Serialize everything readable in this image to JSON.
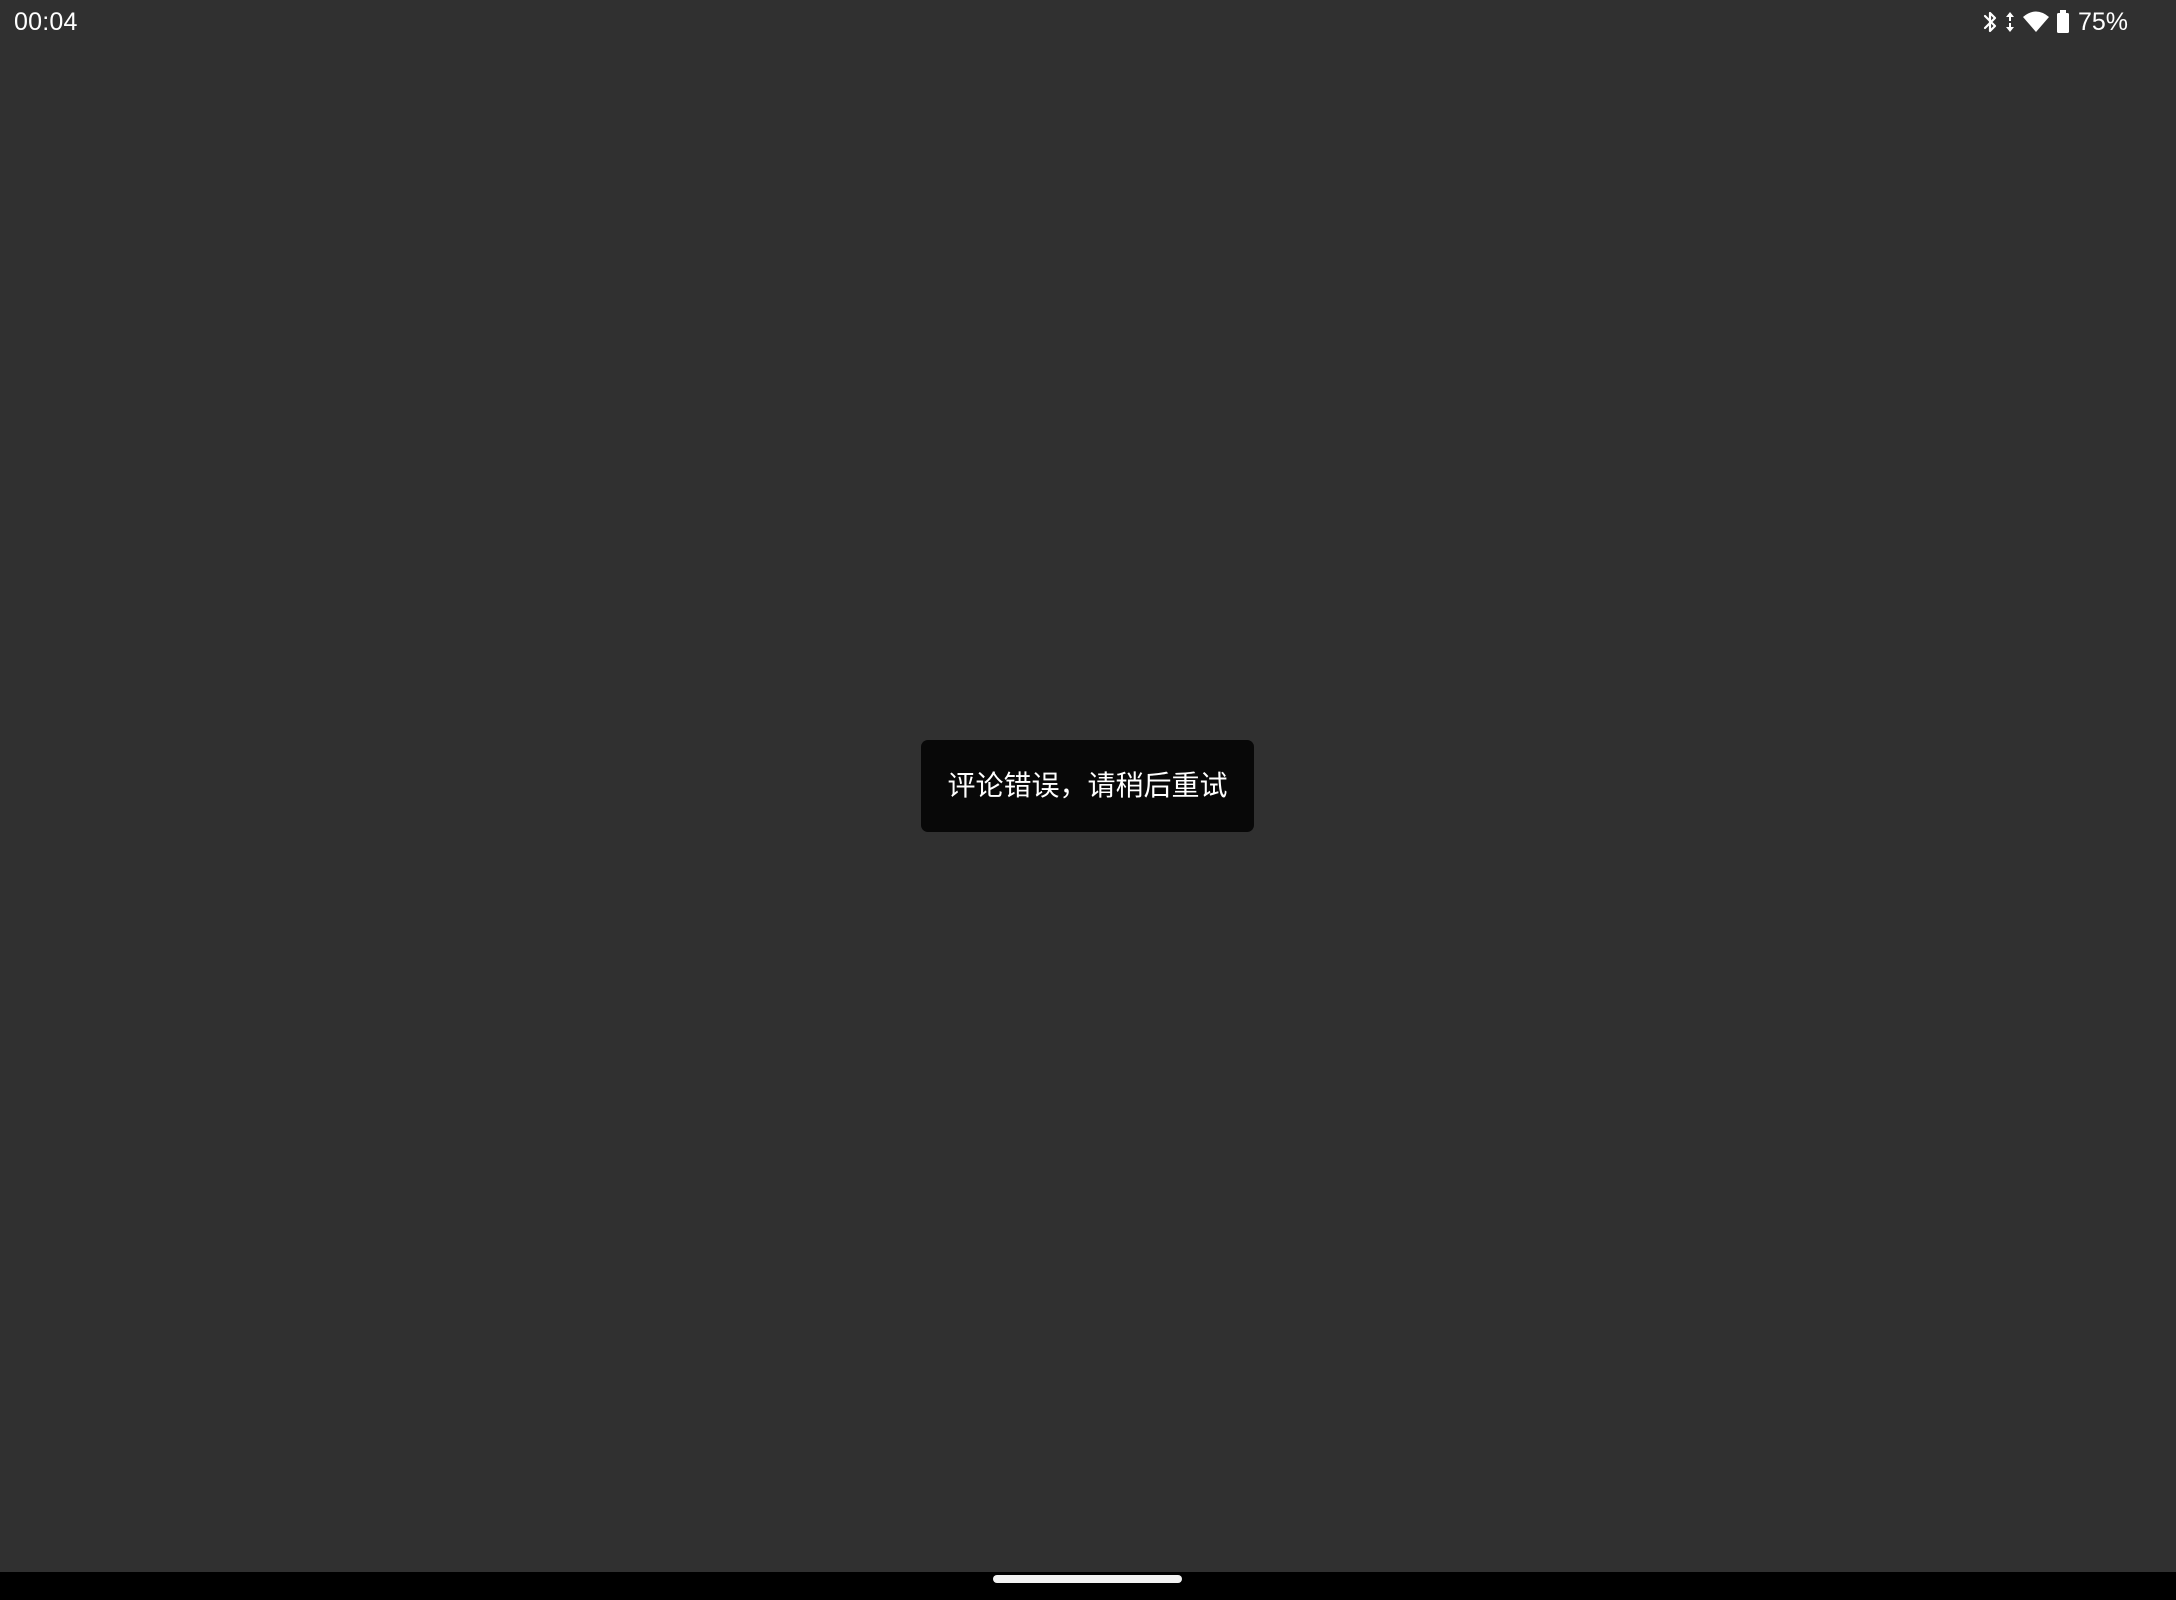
{
  "status_bar": {
    "time": "00:04",
    "battery_percent": "75%",
    "icons": [
      "bluetooth-icon",
      "data-arrows-icon",
      "wifi-icon",
      "battery-icon"
    ],
    "battery_level": 0.75
  },
  "toast": {
    "message": "评论错误，请稍后重试"
  },
  "colors": {
    "background": "#303030",
    "toast_background": "#080808",
    "text": "#ffffff",
    "nav_bar": "#000000"
  }
}
